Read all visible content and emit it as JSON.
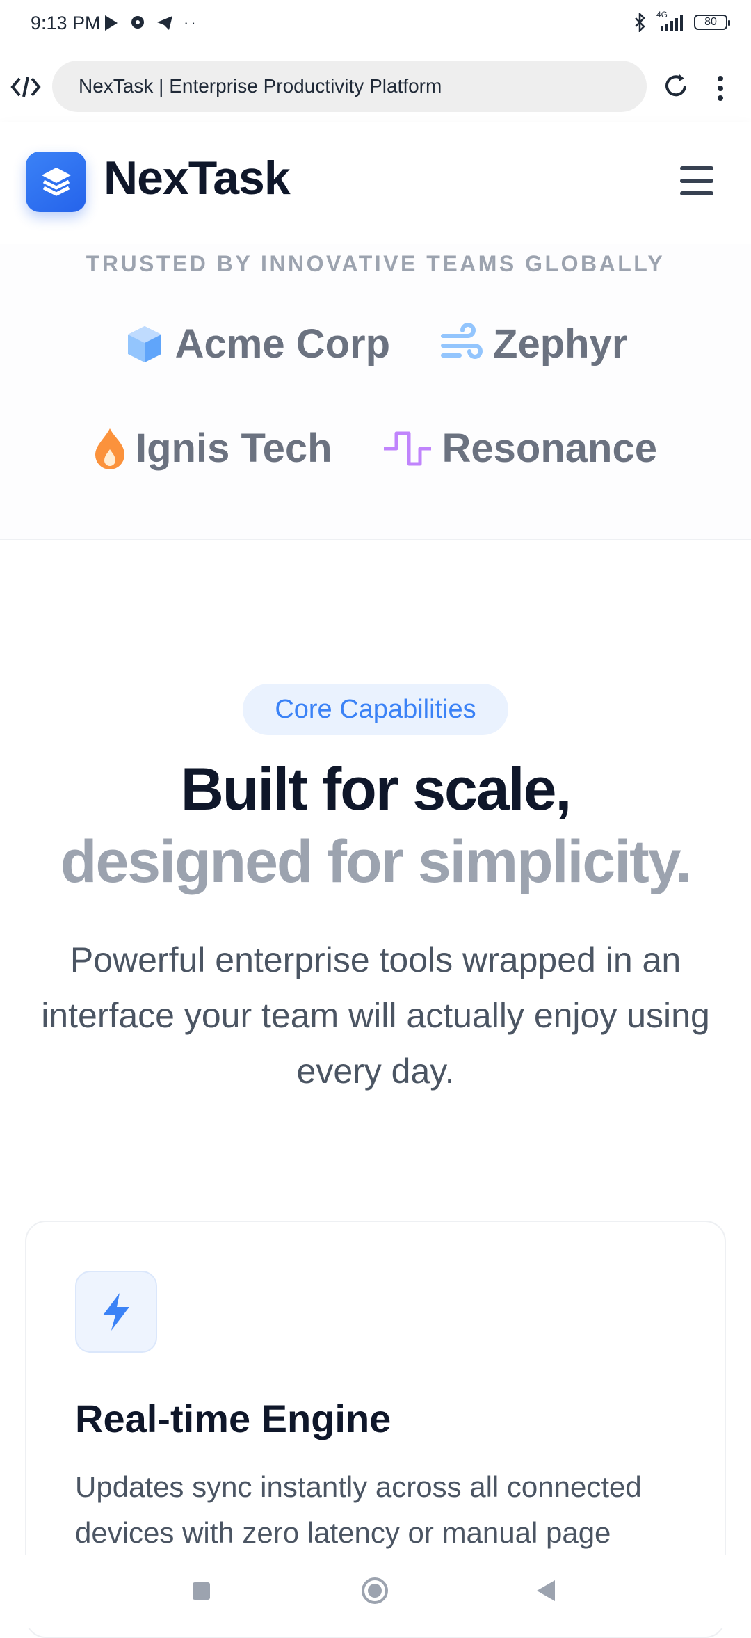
{
  "status_bar": {
    "time": "9:13 PM",
    "network": "4G",
    "battery": "80"
  },
  "browser": {
    "url_title": "NexTask | Enterprise Productivity Platform"
  },
  "header": {
    "brand": "NexTask"
  },
  "trusted": {
    "heading": "TRUSTED BY INNOVATIVE TEAMS GLOBALLY",
    "brands": [
      {
        "name": "Acme Corp",
        "icon": "cube-icon",
        "color": "#60a5fa"
      },
      {
        "name": "Zephyr",
        "icon": "wind-icon",
        "color": "#93c5fd"
      },
      {
        "name": "Ignis Tech",
        "icon": "flame-icon",
        "color": "#fb923c"
      },
      {
        "name": "Resonance",
        "icon": "pulse-icon",
        "color": "#c084fc"
      }
    ]
  },
  "features": {
    "badge": "Core Capabilities",
    "headline_line1": "Built for scale,",
    "headline_line2": "designed for simplicity.",
    "subtext": "Powerful enterprise tools wrapped in an interface your team will actually enjoy using every day.",
    "cards": [
      {
        "icon": "lightning-icon",
        "title": "Real-time Engine",
        "description": "Updates sync instantly across all connected devices with zero latency or manual page"
      }
    ]
  },
  "colors": {
    "accent": "#3b82f6",
    "text_dark": "#0f172a",
    "text_muted": "#9ca3af"
  }
}
